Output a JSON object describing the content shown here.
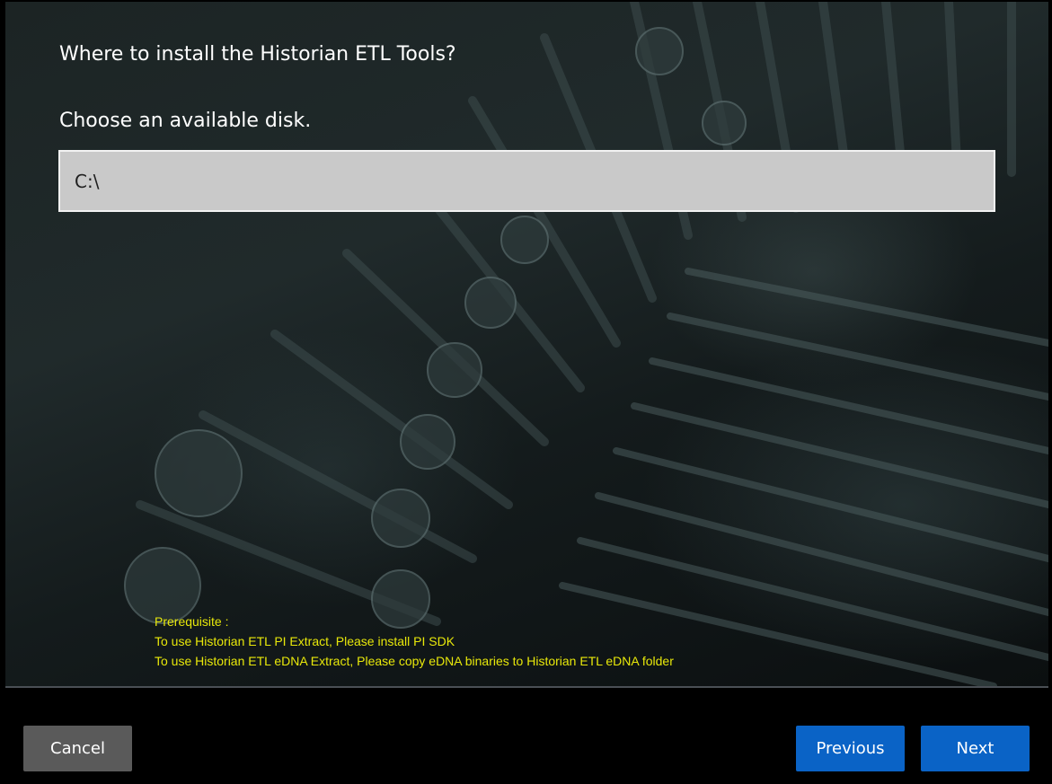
{
  "installer": {
    "title": "Where to install the Historian ETL Tools?",
    "subtitle": "Choose an available disk.",
    "disk": {
      "value": "C:\\"
    },
    "prerequisite": {
      "heading": "Prerequisite :",
      "lines": [
        "To use Historian ETL PI Extract, Please install PI SDK",
        "To use Historian ETL eDNA Extract, Please copy eDNA binaries to Historian ETL eDNA folder"
      ]
    },
    "buttons": {
      "cancel": "Cancel",
      "previous": "Previous",
      "next": "Next"
    }
  },
  "colors": {
    "accent": "#0a63c6",
    "cancel_bg": "#5a5a5a",
    "prereq_text": "#e8e80a",
    "field_bg": "#c9c9c9"
  }
}
